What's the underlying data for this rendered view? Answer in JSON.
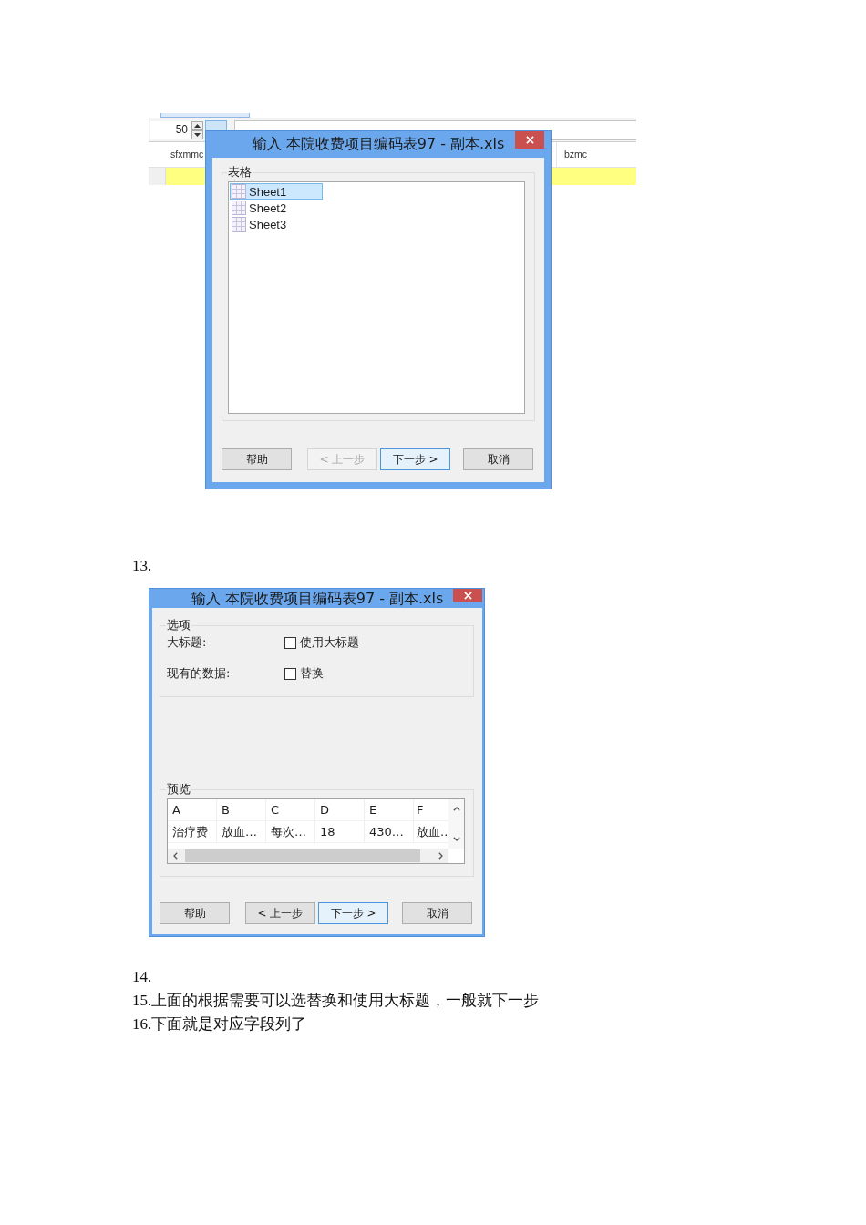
{
  "figure_1": {
    "background_app": {
      "rows_value": "50",
      "columns": [
        "sfxmmc",
        "bzmc"
      ]
    },
    "dialog": {
      "title": "输入 本院收费项目编码表97 - 副本.xls",
      "group_title": "表格",
      "sheets": [
        {
          "label": "Sheet1",
          "selected": true
        },
        {
          "label": "Sheet2",
          "selected": false
        },
        {
          "label": "Sheet3",
          "selected": false
        }
      ],
      "buttons": [
        {
          "label": "帮助",
          "disabled": false,
          "focused": false
        },
        {
          "label": "< 上一步",
          "disabled": true,
          "focused": false
        },
        {
          "label": "下一步 >",
          "disabled": false,
          "focused": true
        },
        {
          "label": "取消",
          "disabled": false,
          "focused": false
        }
      ]
    }
  },
  "caption_13": "13.",
  "figure_2": {
    "dialog": {
      "title": "输入 本院收费项目编码表97 - 副本.xls",
      "options": {
        "title": "选项",
        "rows": [
          {
            "label": "大标题:",
            "option": "使用大标题",
            "checked": false
          },
          {
            "label": "现有的数据:",
            "option": "替换",
            "checked": false
          }
        ]
      },
      "preview": {
        "title": "预览",
        "columns": [
          "A",
          "B",
          "C",
          "D",
          "E",
          "F"
        ],
        "rows": [
          [
            "治疗费",
            "放血…",
            "每次…",
            "18",
            "430…",
            "放血.."
          ]
        ]
      },
      "buttons": [
        {
          "label": "帮助",
          "disabled": false,
          "focused": false
        },
        {
          "label": "< 上一步",
          "disabled": false,
          "focused": false
        },
        {
          "label": "下一步 >",
          "disabled": false,
          "focused": true
        },
        {
          "label": "取消",
          "disabled": false,
          "focused": false
        }
      ]
    }
  },
  "notes": [
    "14.",
    "15.上面的根据需要可以选替换和使用大标题，一般就下一步",
    "16.下面就是对应字段列了"
  ]
}
